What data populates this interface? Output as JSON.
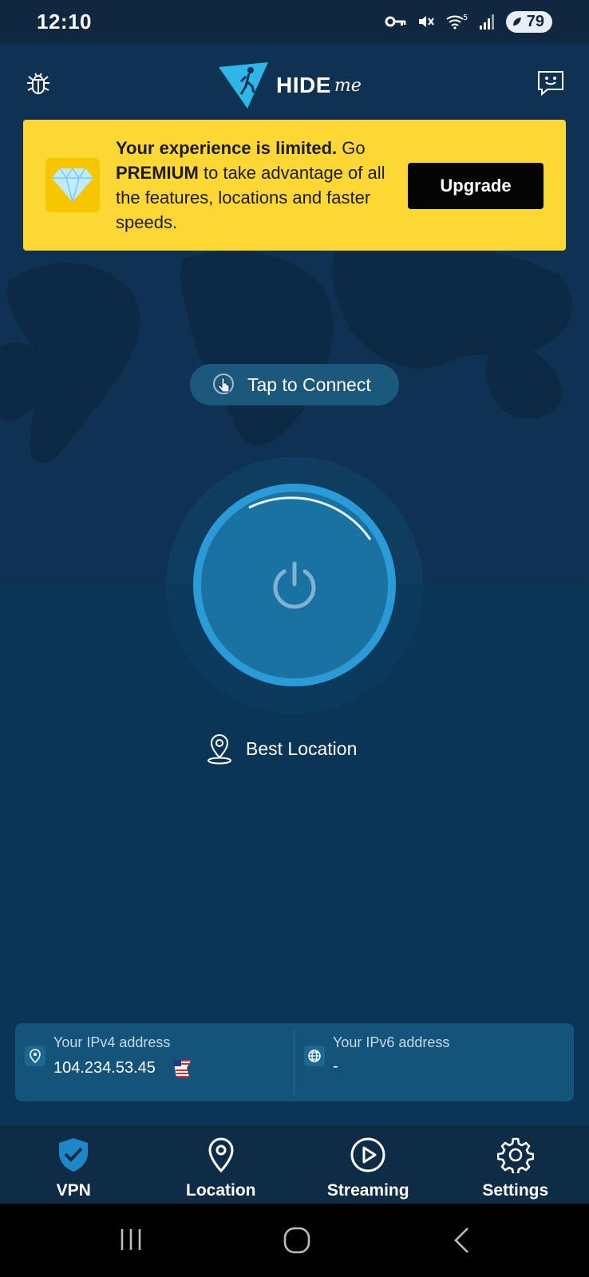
{
  "status_bar": {
    "time": "12:10",
    "battery": "79"
  },
  "header": {
    "logo_text": "HIDE",
    "logo_suffix": "me"
  },
  "banner": {
    "bold_lead": "Your experience is limited.",
    "text_mid1": " Go ",
    "bold_premium": "PREMIUM",
    "text_tail": " to take advantage of all the features, locations and faster speeds.",
    "upgrade_label": "Upgrade"
  },
  "connect": {
    "tap_label": "Tap to Connect",
    "location_label": "Best Location"
  },
  "ip": {
    "v4_label": "Your IPv4 address",
    "v4_value": "104.234.53.45",
    "v6_label": "Your IPv6 address",
    "v6_value": "-"
  },
  "tabs": [
    {
      "label": "VPN",
      "icon": "shield-check-icon"
    },
    {
      "label": "Location",
      "icon": "map-pin-icon"
    },
    {
      "label": "Streaming",
      "icon": "play-circle-icon"
    },
    {
      "label": "Settings",
      "icon": "gear-icon"
    }
  ],
  "colors": {
    "accent": "#2a9bd6",
    "banner": "#fdd835",
    "background": "#0b3556"
  }
}
